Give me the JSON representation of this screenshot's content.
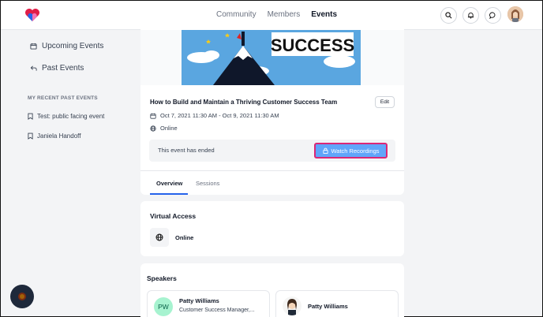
{
  "nav": {
    "links": [
      "Community",
      "Members",
      "Events"
    ],
    "active": "Events"
  },
  "sidebar": {
    "items": [
      {
        "label": "Upcoming Events",
        "icon": "calendar-icon"
      },
      {
        "label": "Past Events",
        "icon": "return-arrow-icon"
      }
    ],
    "recent_heading": "MY RECENT PAST EVENTS",
    "recent": [
      {
        "label": "Test: public facing event",
        "icon": "bookmark-icon"
      },
      {
        "label": "Janiela Handoff",
        "icon": "bookmark-icon"
      }
    ]
  },
  "event": {
    "banner_text": "SUCCESS",
    "title": "How to Build and Maintain a Thriving Customer Success Team",
    "edit_label": "Edit",
    "date_range": "Oct 7, 2021 11:30 AM - Oct 9, 2021 11:30 AM",
    "location": "Online",
    "ended_text": "This event has ended",
    "watch_label": "Watch Recordings"
  },
  "tabs": [
    "Overview",
    "Sessions"
  ],
  "virtual_access": {
    "title": "Virtual Access",
    "value": "Online"
  },
  "speakers": {
    "title": "Speakers",
    "list": [
      {
        "initials": "PW",
        "name": "Patty Williams",
        "role": "Customer Success Manager,..."
      },
      {
        "initials": "",
        "name": "Patty Williams",
        "role": ""
      }
    ]
  },
  "colors": {
    "accent": "#60a5fa",
    "highlight_border": "#db2777",
    "tab_underline": "#2563eb"
  }
}
